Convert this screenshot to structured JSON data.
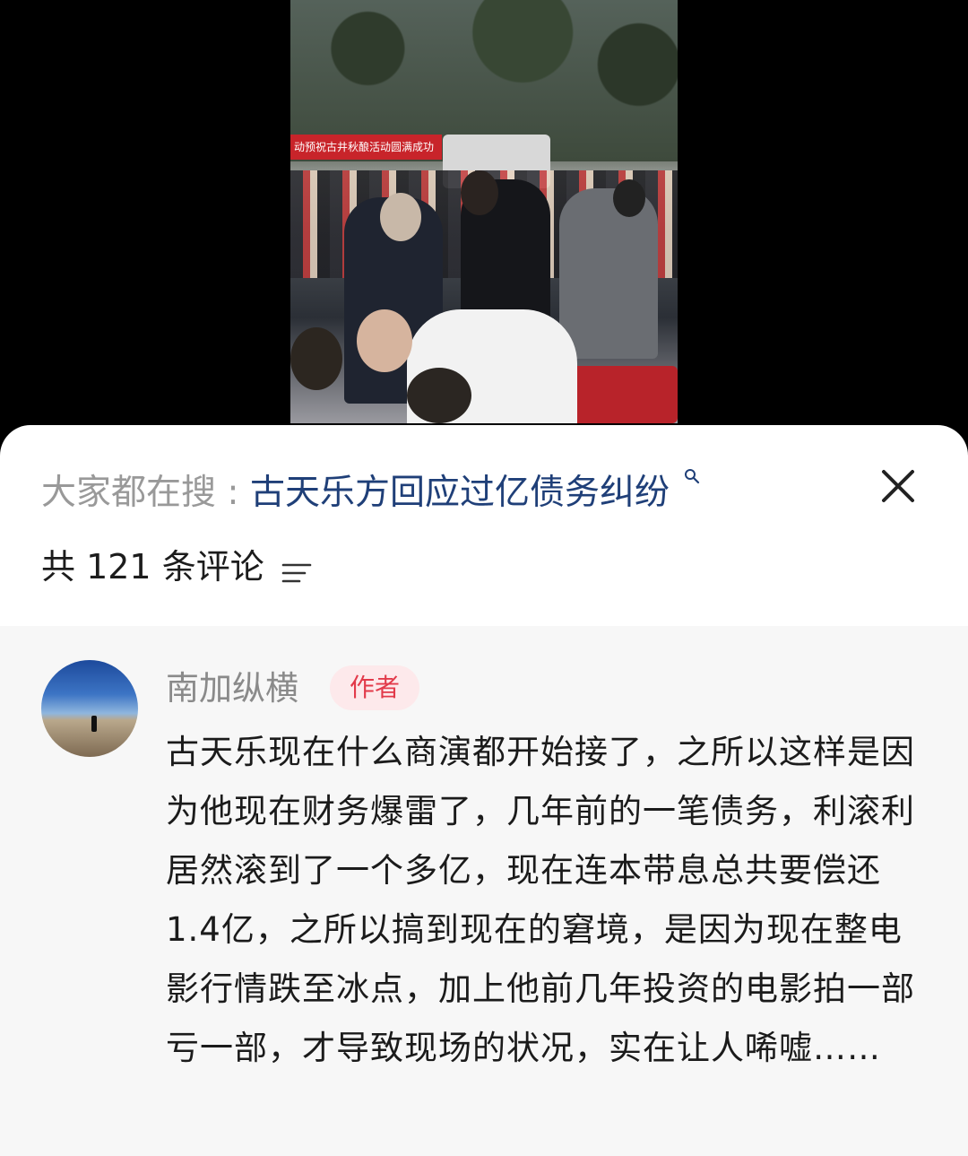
{
  "video": {
    "banner_text": "动预祝古井秋酿活动圆满成功"
  },
  "search": {
    "prefix": "大家都在搜",
    "separator": ":",
    "topic": "古天乐方回应过亿债务纠纷"
  },
  "comments_header": {
    "count_label": "共 121 条评论"
  },
  "comment": {
    "author": "南加纵横",
    "badge": "作者",
    "text": "古天乐现在什么商演都开始接了，之所以这样是因为他现在财务爆雷了，几年前的一笔债务，利滚利居然滚到了一个多亿，现在连本带息总共要偿还1.4亿，之所以搞到现在的窘境，是因为现在整电影行情跌至冰点，加上他前几年投资的电影拍一部亏一部，才导致现场的状况，实在让人唏嘘……"
  },
  "colors": {
    "topic_link": "#1f3f78",
    "badge_text": "#e23a4a",
    "badge_bg": "#fde9eb",
    "comment_bg": "#f7f7f7"
  },
  "icons": {
    "close": "close-icon",
    "search": "search-icon",
    "sort": "sort-icon"
  }
}
